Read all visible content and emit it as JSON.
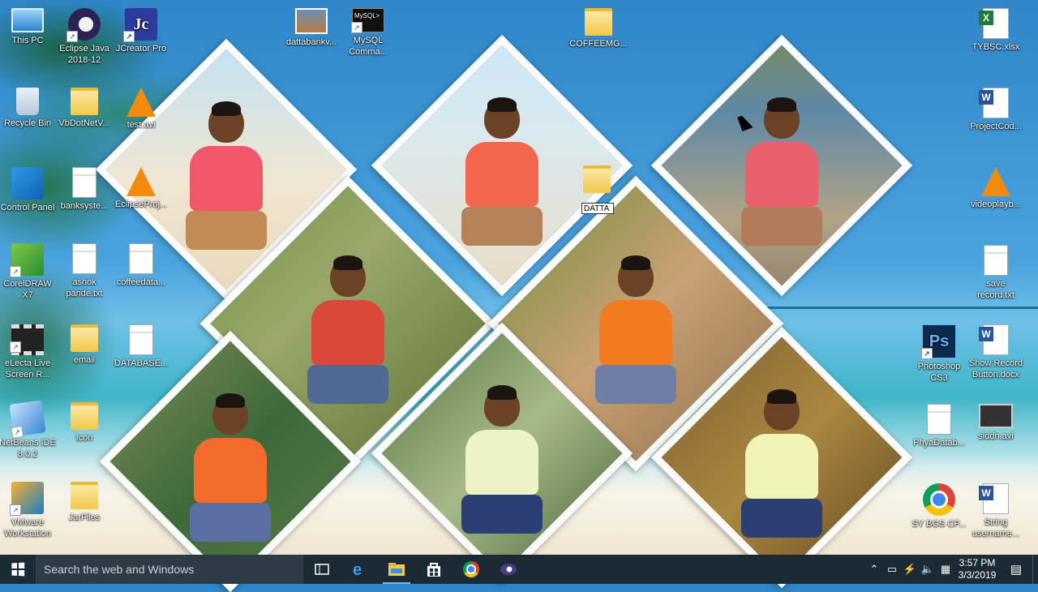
{
  "desktop": {
    "icons": [
      {
        "label": "This PC"
      },
      {
        "label": "Eclipse Java 2018-12"
      },
      {
        "label": "JCreator Pro"
      },
      {
        "label": "dattabankv..."
      },
      {
        "label": "MySQL Comma..."
      },
      {
        "label": "COFFEEMG..."
      },
      {
        "label": "TYBSC.xlsx"
      },
      {
        "label": "Recycle Bin"
      },
      {
        "label": "VbDotNetV..."
      },
      {
        "label": "test.avi"
      },
      {
        "label": "ProjectCod..."
      },
      {
        "label": "Control Panel"
      },
      {
        "label": "banksyste..."
      },
      {
        "label": "EclipseProj..."
      },
      {
        "label": "videoplayb..."
      },
      {
        "label": "CorelDRAW X7"
      },
      {
        "label": "ashok pande.txt"
      },
      {
        "label": "coffeedata..."
      },
      {
        "label": "save record.txt"
      },
      {
        "label": "eLecta Live Screen R..."
      },
      {
        "label": "email"
      },
      {
        "label": "DATABASE..."
      },
      {
        "label": "Photoshop CS3"
      },
      {
        "label": "Show Record Button.docx"
      },
      {
        "label": "NetBeans IDE 8.0.2"
      },
      {
        "label": "Icon"
      },
      {
        "label": "PhyaDatab..."
      },
      {
        "label": "siddh.avi"
      },
      {
        "label": "VMware Workstation"
      },
      {
        "label": "JarFiles"
      },
      {
        "label": "SY BGS CP..."
      },
      {
        "label": "String username..."
      }
    ],
    "rename_value": "DATTA",
    "mysql_icon_text": "MySQL>",
    "jc_letter": "Jc",
    "ps_letters": "Ps"
  },
  "taskbar": {
    "search_placeholder": "Search the web and Windows",
    "time": "3:57 PM",
    "date": "3/3/2019"
  },
  "colors": {
    "taskbar": "#1b2a35",
    "search": "#2e3b46",
    "accent": "#76b9ed"
  }
}
